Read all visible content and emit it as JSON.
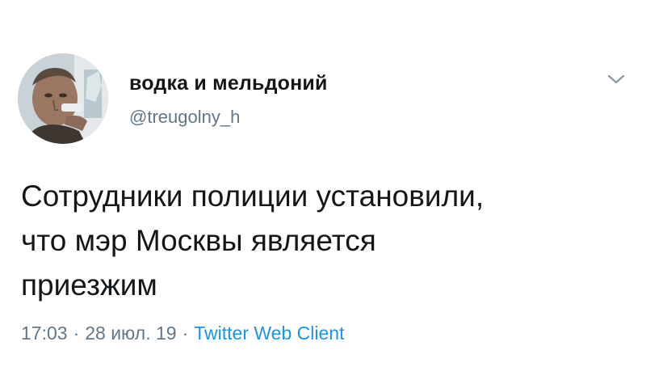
{
  "author": {
    "display_name": "водка и мельдоний",
    "handle": "@treugolny_h",
    "avatar_icon": "user-avatar-photo"
  },
  "menu": {
    "icon": "chevron-down-icon"
  },
  "tweet": {
    "text_lines": [
      "Сотрудники полиции установили,",
      "что мэр Москвы является",
      "приезжим"
    ]
  },
  "meta": {
    "time": "17:03",
    "separator": "·",
    "date": "28 июл. 19",
    "client": "Twitter Web Client"
  },
  "colors": {
    "text_primary": "#14171a",
    "text_secondary": "#657786",
    "link": "#1b95e0"
  }
}
